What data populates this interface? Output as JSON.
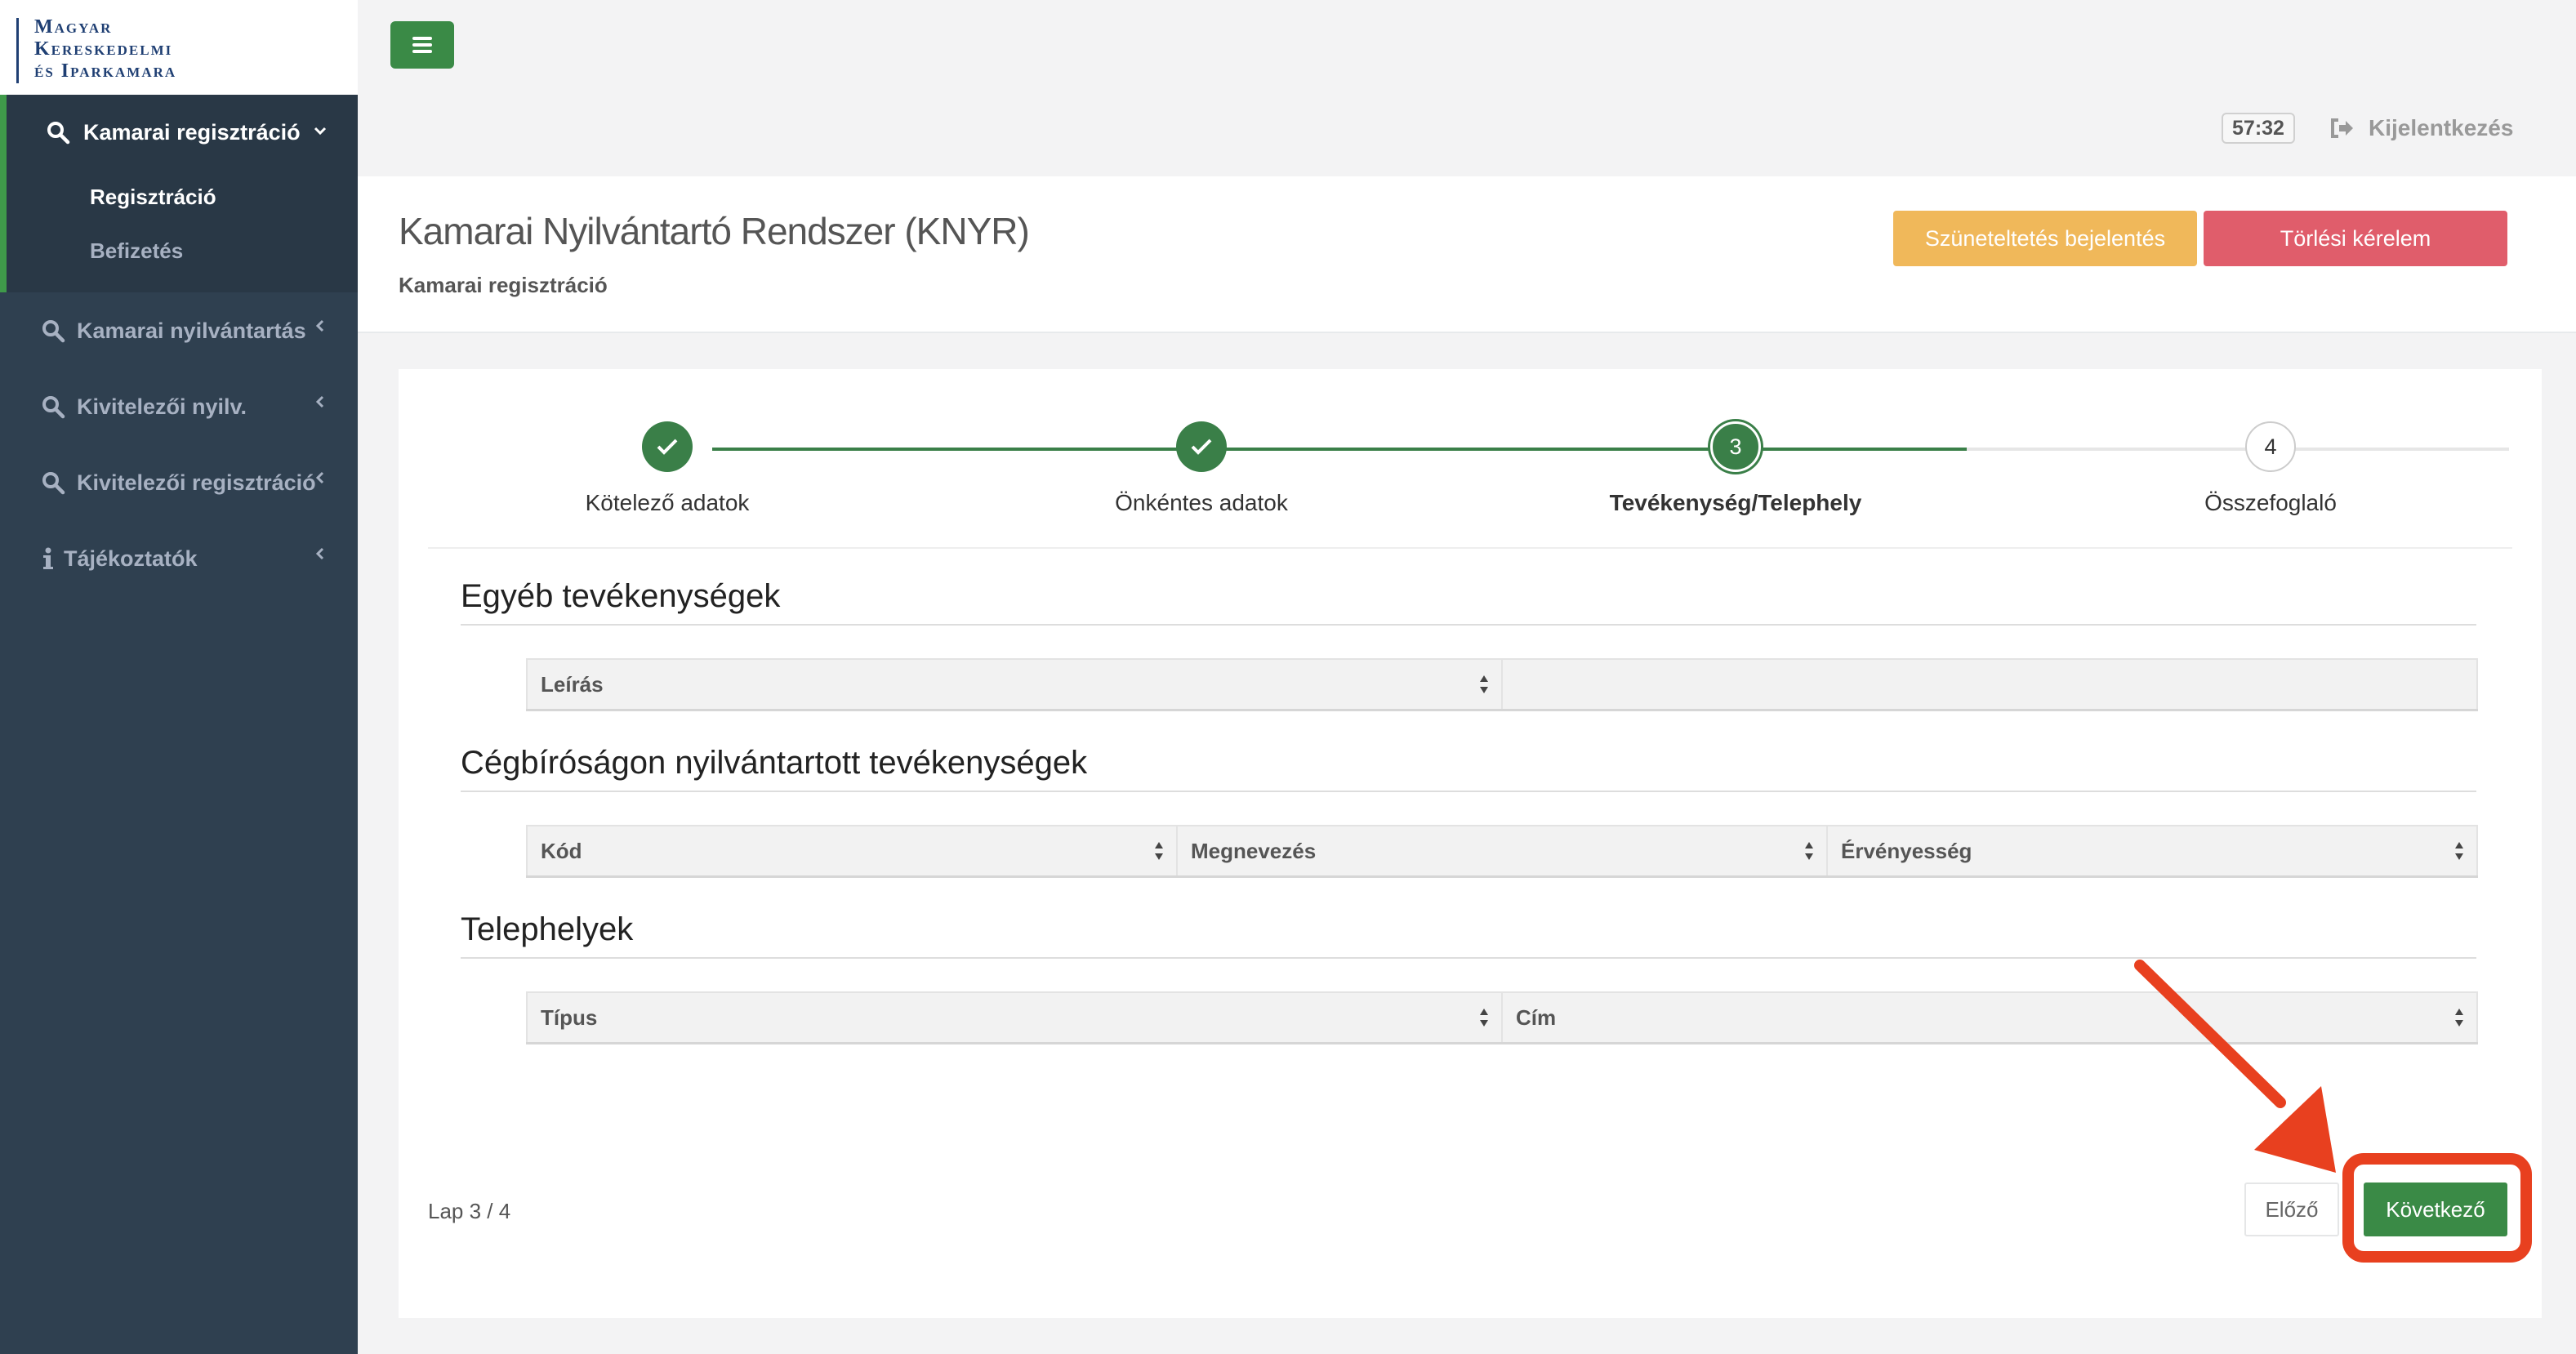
{
  "logo": {
    "lines": [
      "Magyar",
      "Kereskedelmi",
      "és Iparkamara"
    ]
  },
  "sidebar": {
    "items": [
      {
        "label": "Kamarai regisztráció",
        "icon": "search-icon",
        "expanded": true,
        "children": [
          {
            "label": "Regisztráció",
            "active": true
          },
          {
            "label": "Befizetés",
            "active": false
          }
        ]
      },
      {
        "label": "Kamarai nyilvántartás",
        "icon": "search-icon"
      },
      {
        "label": "Kivitelezői nyilv.",
        "icon": "search-icon"
      },
      {
        "label": "Kivitelezői regisztráció",
        "icon": "search-icon"
      },
      {
        "label": "Tájékoztatók",
        "icon": "info-icon"
      }
    ]
  },
  "topbar": {
    "timer": "57:32",
    "logout_label": "Kijelentkezés"
  },
  "header": {
    "title": "Kamarai Nyilvántartó Rendszer (KNYR)",
    "breadcrumb": "Kamarai regisztráció",
    "suspend_label": "Szüneteltetés bejelentés",
    "delete_label": "Törlési kérelem"
  },
  "steps": [
    {
      "label": "Kötelező adatok",
      "state": "done"
    },
    {
      "label": "Önkéntes adatok",
      "state": "done"
    },
    {
      "label": "Tevékenység/Telephely",
      "number": "3",
      "state": "current"
    },
    {
      "label": "Összefoglaló",
      "number": "4",
      "state": "todo"
    }
  ],
  "sections": {
    "other": {
      "title": "Egyéb tevékenységek",
      "columns": [
        "Leírás",
        ""
      ]
    },
    "registered": {
      "title": "Cégbíróságon nyilvántartott tevékenységek",
      "columns": [
        "Kód",
        "Megnevezés",
        "Érvényesség"
      ]
    },
    "sites": {
      "title": "Telephelyek",
      "columns": [
        "Típus",
        "Cím"
      ]
    }
  },
  "footer": {
    "page_info": "Lap 3 / 4",
    "prev_label": "Előző",
    "next_label": "Következő"
  },
  "colors": {
    "accent": "#3a8a46",
    "sidebar": "#2f4050",
    "warning": "#f0b85a",
    "danger": "#e05d6b",
    "annotation": "#e8401f"
  }
}
